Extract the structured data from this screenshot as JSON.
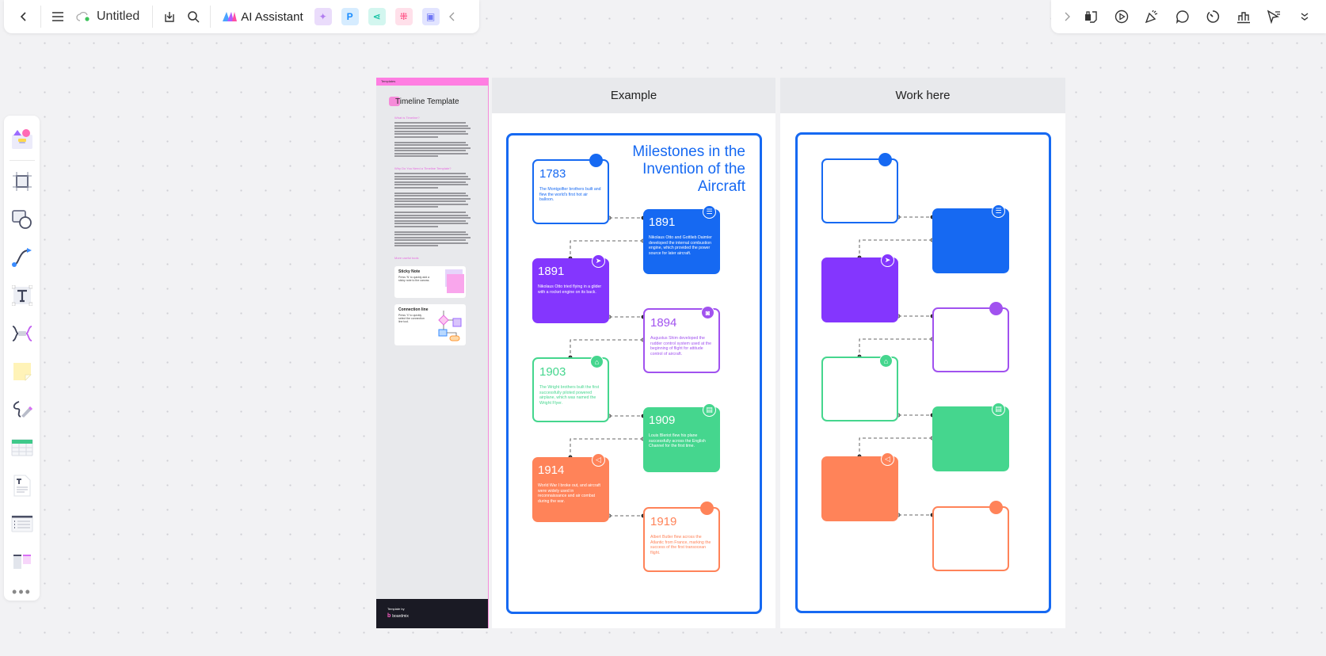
{
  "toolbar": {
    "back_icon": "chevron-left-icon",
    "menu_icon": "hamburger-menu-icon",
    "doc_title": "Untitled",
    "sync_status": "cloud-synced",
    "ai_label": "AI Assistant",
    "apps": [
      {
        "name": "ai-image",
        "glyph": "✦",
        "bg": "#eadcfb",
        "fg": "#b27ef0"
      },
      {
        "name": "presentation",
        "glyph": "P",
        "bg": "#d6ecff",
        "fg": "#1a8cff"
      },
      {
        "name": "mindmap",
        "glyph": "⋖",
        "bg": "#d3f6ef",
        "fg": "#17c3a5"
      },
      {
        "name": "flowchart",
        "glyph": "⁜",
        "bg": "#ffe0ea",
        "fg": "#ff5f8f"
      },
      {
        "name": "chat",
        "glyph": "▣",
        "bg": "#e2e4ff",
        "fg": "#7077f5"
      }
    ],
    "collapse_icon": "chevron-left-icon"
  },
  "right_toolbar": {
    "expand_icon": "chevron-right-icon",
    "tools": [
      "template-icon",
      "play-icon",
      "celebrate-icon",
      "comment-icon",
      "timer-icon",
      "vote-icon",
      "laser-pointer-icon",
      "more-chevron-down-icon"
    ]
  },
  "sidebar": {
    "items": [
      {
        "name": "templates",
        "icon": "templates-icon"
      },
      {
        "name": "frame",
        "icon": "frame-icon"
      },
      {
        "name": "shapes",
        "icon": "shapes-icon"
      },
      {
        "name": "connector",
        "icon": "connector-icon"
      },
      {
        "name": "text",
        "icon": "text-icon",
        "glyph": "T"
      },
      {
        "name": "mindmap",
        "icon": "mindmap-icon"
      },
      {
        "name": "sticky-note",
        "icon": "sticky-note-icon"
      },
      {
        "name": "pen",
        "icon": "pen-icon"
      },
      {
        "name": "table",
        "icon": "table-icon"
      },
      {
        "name": "document",
        "icon": "document-icon"
      },
      {
        "name": "list",
        "icon": "list-icon"
      },
      {
        "name": "kanban",
        "icon": "kanban-icon"
      }
    ],
    "more": "•••"
  },
  "template_panel": {
    "top_label": "Templates",
    "title": "Timeline Template",
    "section1": "What is Timeline?",
    "section2": "Why Do You Need a Timeline Template?",
    "section3": "More useful tools",
    "card1_title": "Sticky Note",
    "card1_text": "Press 'N' to quickly add a sticky note to the canvas.",
    "card2_title": "Connection line",
    "card2_text": "Press 'X' to quickly select the connection line tool.",
    "footer_label": "Template by",
    "footer_brand": "boardmix"
  },
  "frames": {
    "example_label": "Example",
    "work_label": "Work here"
  },
  "example": {
    "title_lines": [
      "Milestones in the",
      "Invention of the",
      "Aircraft"
    ],
    "cards": [
      {
        "year": "1783",
        "text": "The Montgolfier brothers built and flew the world's first hot air balloon.",
        "color": "#1669f2",
        "style": "outline",
        "badge": "dot"
      },
      {
        "year": "1891",
        "text": "Nikolaus Otto and Gottlieb Daimler developed the internal combustion engine, which provided the power source for later aircraft.",
        "color": "#1669f2",
        "style": "filled",
        "badge": "document-icon"
      },
      {
        "year": "1891",
        "text": "Nikolaus Otto tried flying in a glider with a rocket engine on its back.",
        "color": "#8436fe",
        "style": "filled",
        "badge": "paper-plane-icon"
      },
      {
        "year": "1894",
        "text": "Augustus Shim developed the rudder control system used at the beginning of flight for attitude control of aircraft.",
        "color": "#a152ef",
        "style": "outline",
        "badge": "camera-icon"
      },
      {
        "year": "1903",
        "text": "The Wright brothers built the first successfully piloted powered airplane, which was named the Wright Flyer.",
        "color": "#45d68e",
        "style": "outline",
        "badge": "home-icon"
      },
      {
        "year": "1909",
        "text": "Louis Bleriot flew his plane successfully across the English Channel for the first time.",
        "color": "#45d68e",
        "style": "filled",
        "badge": "message-icon"
      },
      {
        "year": "1914",
        "text": "World War I broke out, and aircraft were widely used in reconnaissance and air combat during the war.",
        "color": "#ff8359",
        "style": "filled",
        "badge": "speaker-icon"
      },
      {
        "year": "1919",
        "text": "Albert Butler flew across the Atlantic from France, marking the success of the first transocean flight.",
        "color": "#ff8359",
        "style": "outline",
        "badge": "dot"
      }
    ]
  },
  "work": {
    "cards": [
      {
        "color": "#1669f2",
        "style": "outline",
        "badge": "dot"
      },
      {
        "color": "#1669f2",
        "style": "filled",
        "badge": "document-icon"
      },
      {
        "color": "#8436fe",
        "style": "filled",
        "badge": "paper-plane-icon"
      },
      {
        "color": "#a152ef",
        "style": "outline",
        "badge": "dot"
      },
      {
        "color": "#45d68e",
        "style": "outline",
        "badge": "home-icon"
      },
      {
        "color": "#45d68e",
        "style": "filled",
        "badge": "message-icon"
      },
      {
        "color": "#ff8359",
        "style": "filled",
        "badge": "speaker-icon"
      },
      {
        "color": "#ff8359",
        "style": "outline",
        "badge": "dot"
      }
    ]
  }
}
